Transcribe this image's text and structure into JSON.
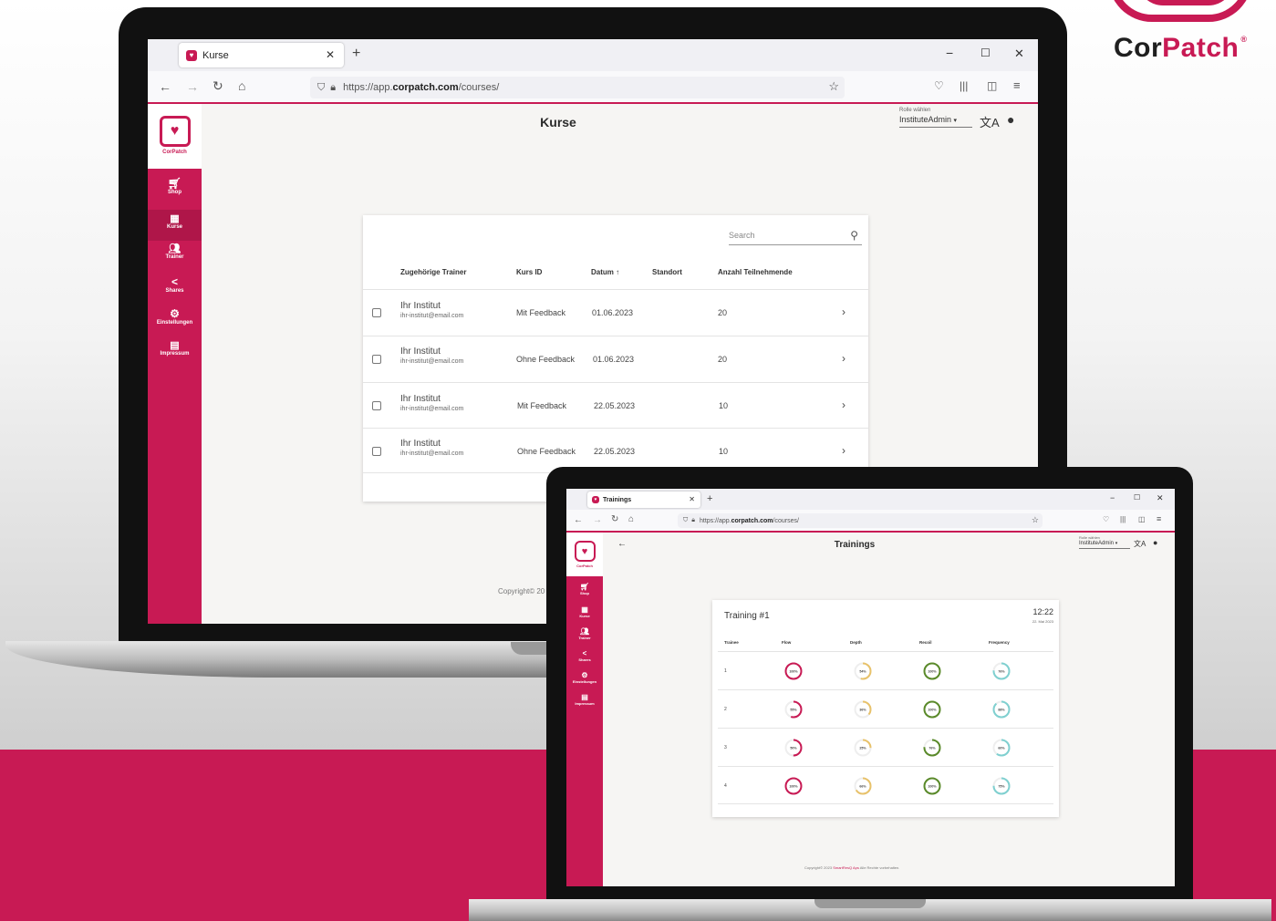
{
  "brand": {
    "name_cor": "Cor",
    "name_patch": "Patch",
    "reg": "®",
    "accent": "#c81a54"
  },
  "big": {
    "tab": {
      "title": "Kurse"
    },
    "url": {
      "prefix": "https://app.",
      "host": "corpatch.com",
      "path": "/courses/"
    },
    "sidebar": {
      "logo_text": "CorPatch",
      "items": [
        {
          "icon": "cart-icon",
          "label": "Shop"
        },
        {
          "icon": "chart-icon",
          "label": "Kurse"
        },
        {
          "icon": "people-icon",
          "label": "Trainer"
        },
        {
          "icon": "share-icon",
          "label": "Shares"
        },
        {
          "icon": "gear-icon",
          "label": "Einstellungen"
        },
        {
          "icon": "news-icon",
          "label": "Impressum"
        }
      ]
    },
    "page_title": "Kurse",
    "role_label": "Rolle wählen",
    "role_value": "InstituteAdmin",
    "search_placeholder": "Search",
    "columns": [
      "Zugehörige Trainer",
      "Kurs ID",
      "Datum ↑",
      "Standort",
      "Anzahl Teilnehmende"
    ],
    "rows": [
      {
        "trainer": "Ihr Institut",
        "email": "ihr-institut@email.com",
        "kurs": "Mit Feedback",
        "datum": "01.06.2023",
        "standort": "",
        "anzahl": "20"
      },
      {
        "trainer": "Ihr Institut",
        "email": "ihr-institut@email.com",
        "kurs": "Ohne Feedback",
        "datum": "01.06.2023",
        "standort": "",
        "anzahl": "20"
      },
      {
        "trainer": "Ihr Institut",
        "email": "ihr-institut@email.com",
        "kurs": "Mit Feedback",
        "datum": "22.05.2023",
        "standort": "",
        "anzahl": "10"
      },
      {
        "trainer": "Ihr Institut",
        "email": "ihr-institut@email.com",
        "kurs": "Ohne Feedback",
        "datum": "22.05.2023",
        "standort": "",
        "anzahl": "10"
      }
    ],
    "copyright": "Copyright© 20"
  },
  "small": {
    "tab": {
      "title": "Trainings"
    },
    "url": {
      "prefix": "https://app.",
      "host": "corpatch.com",
      "path": "/courses/"
    },
    "sidebar": {
      "logo_text": "CorPatch",
      "items": [
        {
          "icon": "cart-icon",
          "label": "Shop"
        },
        {
          "icon": "chart-icon",
          "label": "Kurse"
        },
        {
          "icon": "people-icon",
          "label": "Trainer"
        },
        {
          "icon": "share-icon",
          "label": "Shares"
        },
        {
          "icon": "gear-icon",
          "label": "Einstellungen"
        },
        {
          "icon": "news-icon",
          "label": "Impressum"
        }
      ]
    },
    "page_title": "Trainings",
    "role_label": "Rolle wählen",
    "role_value": "InstituteAdmin",
    "training": {
      "title": "Training #1",
      "time": "12:22",
      "date": "22. Mai 2023"
    },
    "columns": [
      "Trainee",
      "Flow",
      "Depth",
      "Recoil",
      "Frequency"
    ],
    "metric_colors": {
      "flow": "#c81a54",
      "depth": "#e8c26a",
      "recoil": "#5a8a2a",
      "frequency": "#7fd0d0"
    },
    "trainees": [
      {
        "id": "1",
        "flow": 100,
        "depth": 54,
        "recoil": 100,
        "frequency": 76
      },
      {
        "id": "2",
        "flow": 55,
        "depth": 36,
        "recoil": 100,
        "frequency": 88
      },
      {
        "id": "3",
        "flow": 50,
        "depth": 25,
        "recoil": 76,
        "frequency": 60
      },
      {
        "id": "4",
        "flow": 100,
        "depth": 66,
        "recoil": 100,
        "frequency": 75
      }
    ],
    "copyright_prefix": "Copyright© 2023 ",
    "copyright_brand": "SmartResQ Aps",
    "copyright_suffix": " Alle Rechte vorbehalten."
  }
}
